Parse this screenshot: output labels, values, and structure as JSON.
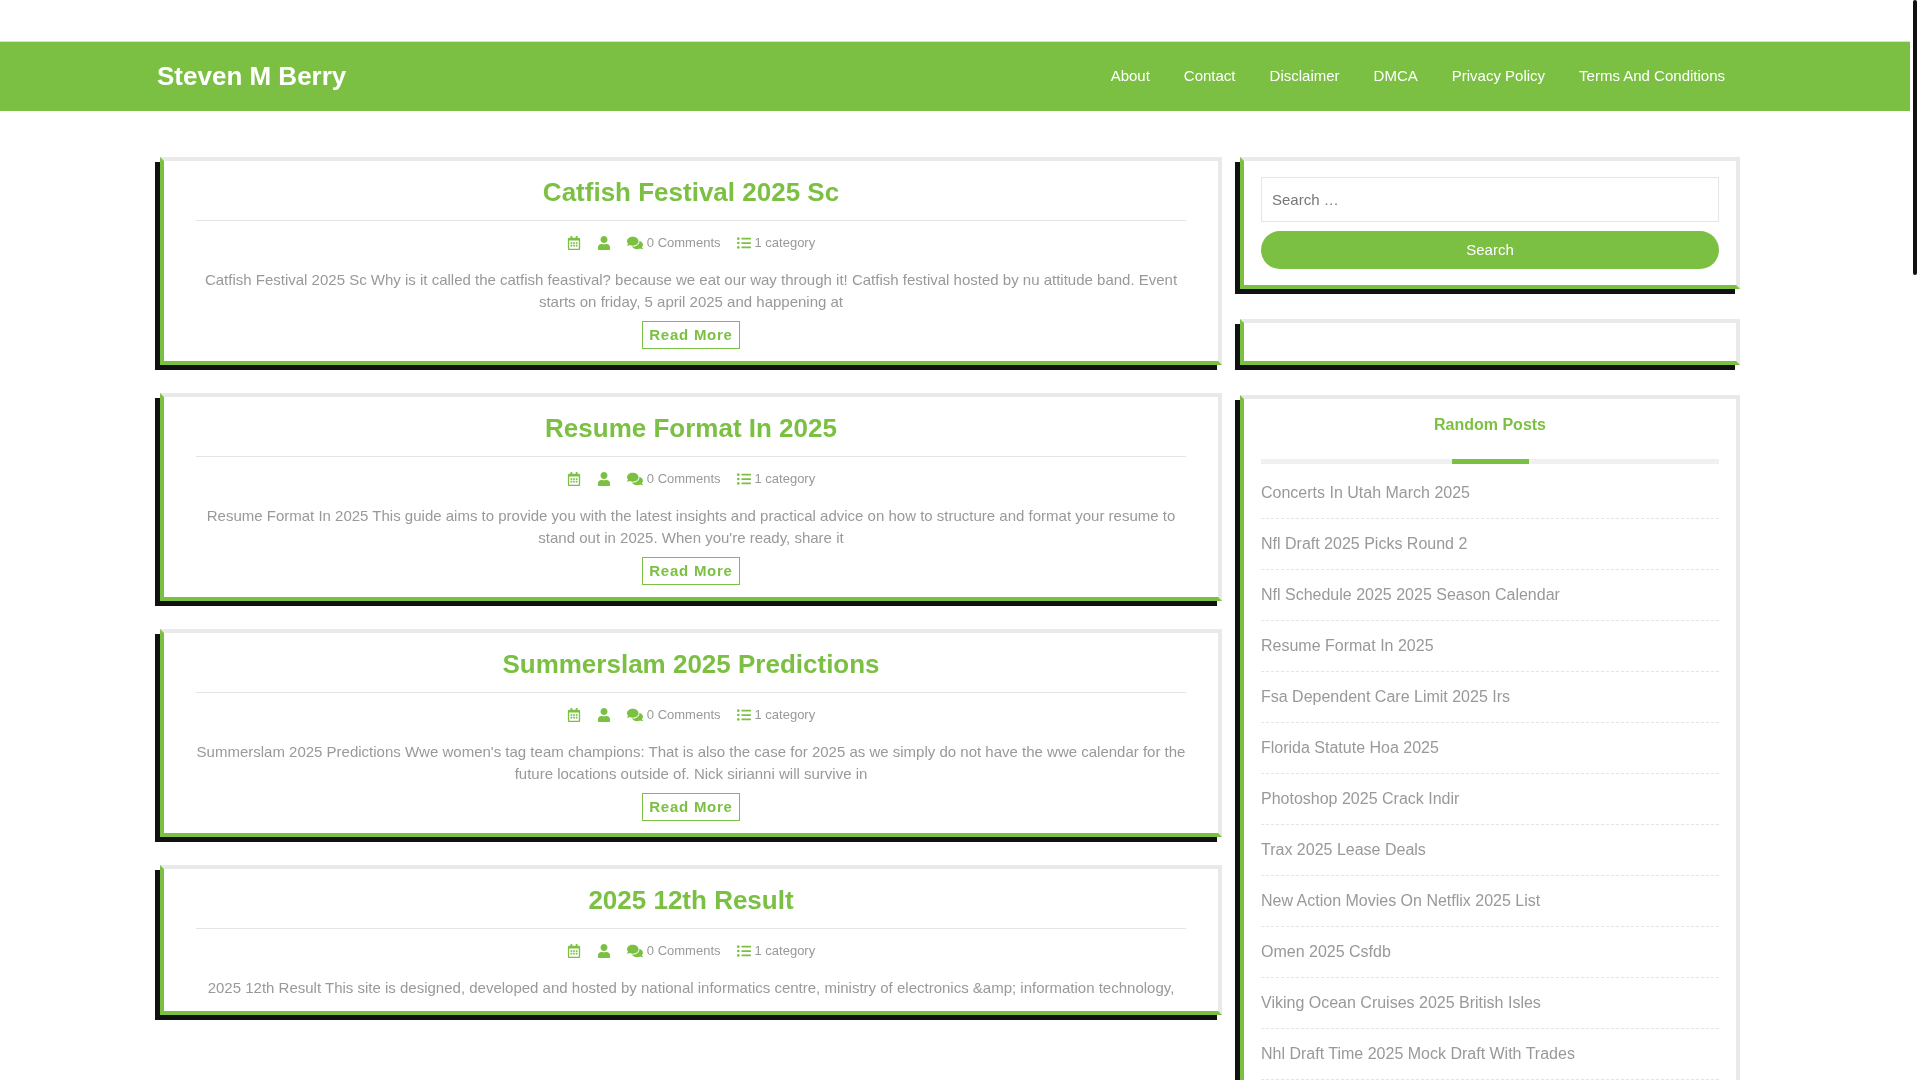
{
  "site": {
    "title": "Steven M Berry"
  },
  "nav": [
    "About",
    "Contact",
    "Disclaimer",
    "DMCA",
    "Privacy Policy",
    "Terms And Conditions"
  ],
  "posts": [
    {
      "title": "Catfish Festival 2025 Sc",
      "comments": "0 Comments",
      "category": "1 category",
      "excerpt": "Catfish Festival 2025 Sc Why is it called the catfish feastival? because we eat our way through it! Catfish festival hosted by nu attitude band. Event starts on friday, 5 april 2025 and happening at",
      "read_more": "Read More"
    },
    {
      "title": "Resume Format In 2025",
      "comments": "0 Comments",
      "category": "1 category",
      "excerpt": "Resume Format In 2025 This guide aims to provide you with the latest insights and practical advice on how to structure and format your resume to stand out in 2025. When you're ready, share it",
      "read_more": "Read More"
    },
    {
      "title": "Summerslam 2025 Predictions",
      "comments": "0 Comments",
      "category": "1 category",
      "excerpt": "Summerslam 2025 Predictions Wwe women's tag team champions: That is also the case for 2025 as we simply do not have the wwe calendar for the future locations outside of. Nick sirianni will survive in",
      "read_more": "Read More"
    },
    {
      "title": "2025 12th Result",
      "comments": "0 Comments",
      "category": "1 category",
      "excerpt": "2025 12th Result This site is designed, developed and hosted by national informatics centre, ministry of electronics &amp; information technology,"
    }
  ],
  "sidebar": {
    "search": {
      "placeholder": "Search …",
      "button": "Search"
    },
    "random_posts": {
      "title": "Random Posts",
      "items": [
        "Concerts In Utah March 2025",
        "Nfl Draft 2025 Picks Round 2",
        "Nfl Schedule 2025 2025 Season Calendar",
        "Resume Format In 2025",
        "Fsa Dependent Care Limit 2025 Irs",
        "Florida Statute Hoa 2025",
        "Photoshop 2025 Crack Indir",
        "Trax 2025 Lease Deals",
        "New Action Movies On Netflix 2025 List",
        "Omen 2025 Csfdb",
        "Viking Ocean Cruises 2025 British Isles",
        "Nhl Draft Time 2025 Mock Draft With Trades"
      ]
    }
  }
}
